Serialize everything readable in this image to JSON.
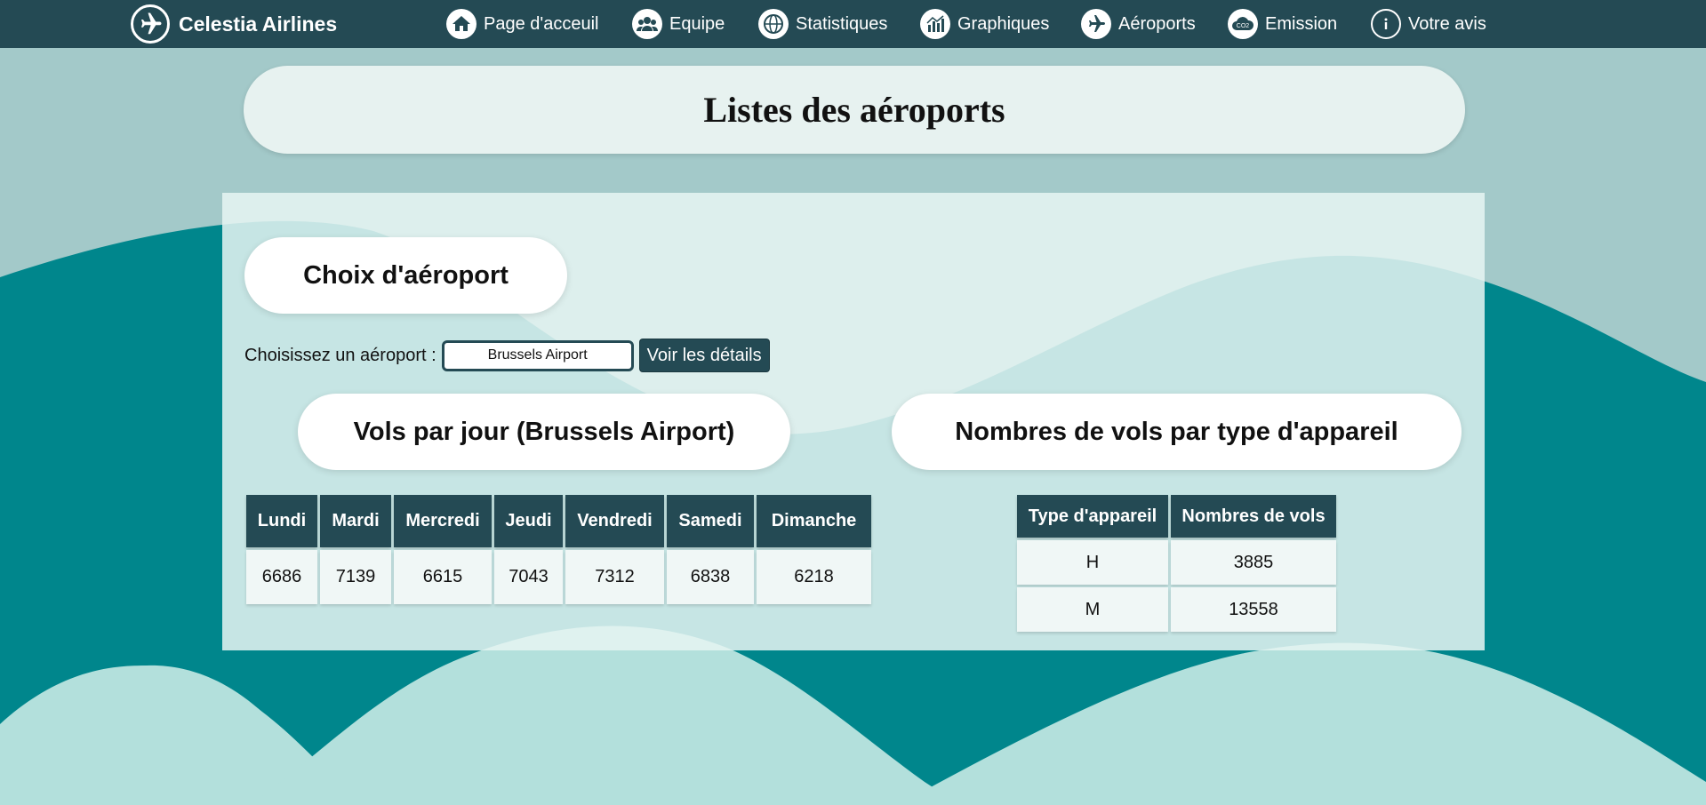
{
  "nav": {
    "brand": "Celestia Airlines",
    "items": [
      {
        "label": "Page d'acceuil",
        "icon": "home-icon"
      },
      {
        "label": "Equipe",
        "icon": "team-icon"
      },
      {
        "label": "Statistiques",
        "icon": "globe-stats-icon"
      },
      {
        "label": "Graphiques",
        "icon": "bar-chart-icon"
      },
      {
        "label": "Aéroports",
        "icon": "plane-icon"
      },
      {
        "label": "Emission",
        "icon": "co2-cloud-icon"
      },
      {
        "label": "Votre avis",
        "icon": "info-icon"
      }
    ]
  },
  "page": {
    "title": "Listes des aéroports"
  },
  "selector": {
    "heading": "Choix d'aéroport",
    "label": "Choisissez un aéroport :",
    "value": "Brussels Airport",
    "button": "Voir les détails"
  },
  "flights_per_day": {
    "heading": "Vols par jour (Brussels Airport)",
    "columns": [
      "Lundi",
      "Mardi",
      "Mercredi",
      "Jeudi",
      "Vendredi",
      "Samedi",
      "Dimanche"
    ],
    "values": [
      "6686",
      "7139",
      "6615",
      "7043",
      "7312",
      "6838",
      "6218"
    ]
  },
  "aircraft": {
    "heading": "Nombres de vols par type d'appareil",
    "columns": [
      "Type d'appareil",
      "Nombres de vols"
    ],
    "rows": [
      [
        "H",
        "3885"
      ],
      [
        "M",
        "13558"
      ]
    ]
  },
  "colors": {
    "navbar": "#244a54",
    "teal": "#00868c",
    "light_teal": "#b3e0dc",
    "background": "#a3c9c9"
  }
}
